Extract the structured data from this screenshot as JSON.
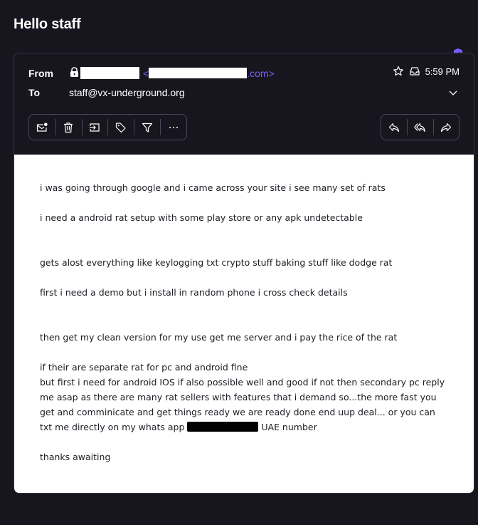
{
  "email": {
    "subject": "Hello staff",
    "from_label": "From",
    "from_address_suffix": ".com>",
    "from_address_prefix": "<",
    "to_label": "To",
    "to_value": "staff@vx-underground.org",
    "time": "5:59 PM",
    "accent_color": "#7c5cff"
  },
  "toolbar": {
    "left_buttons": [
      "mark-unread",
      "delete",
      "move",
      "label",
      "filter",
      "more"
    ],
    "right_buttons": [
      "reply",
      "reply-all",
      "forward"
    ],
    "more_label": "···"
  },
  "body": {
    "p1": "i was going through google and i came across your site i see many set of rats",
    "p2": "i need a android rat setup with some play store or any apk undetectable",
    "p3": "gets alost everything like keylogging txt crypto stuff baking stuff like dodge rat",
    "p4": "first i need a demo but i install in random phone i cross check details",
    "p5": "then get my clean version for my use get me server and i pay the rice of the rat",
    "p6a": "if their are separate rat for pc and android fine\nbut first i need for android IOS if also possible well and good if not then secondary pc reply me asap as there are many rat sellers with features that i demand so...the more fast you get and comminicate and get things ready we are ready done end uup deal... or you can txt me directly on my whats app ",
    "p6b": " UAE number",
    "p7": "thanks awaiting"
  }
}
